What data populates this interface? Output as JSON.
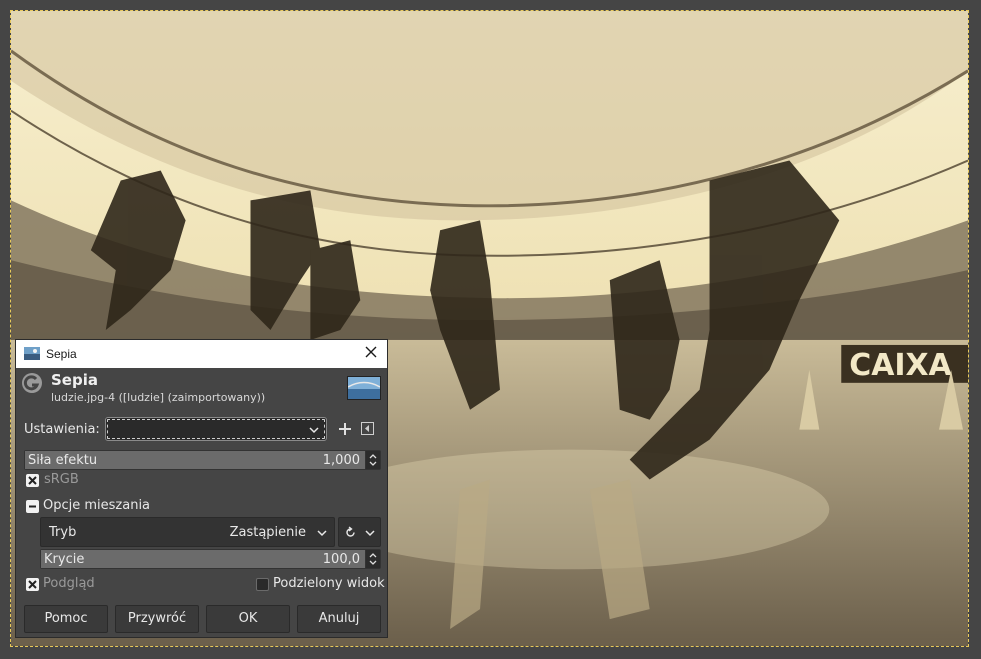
{
  "dialog": {
    "window_title": "Sepia",
    "filter_title": "Sepia",
    "image_info": "ludzie.jpg-4 ([ludzie] (zaimportowany))",
    "settings": {
      "label": "Ustawienia:",
      "value": ""
    },
    "strength": {
      "label": "Siła efektu",
      "value": "1,000",
      "fraction": 1.0
    },
    "srgb": {
      "label": "sRGB",
      "checked": true
    },
    "blending": {
      "label": "Opcje mieszania",
      "expanded": true,
      "mode_label": "Tryb",
      "mode_value": "Zastąpienie",
      "opacity_label": "Krycie",
      "opacity_value": "100,0",
      "opacity_fraction": 1.0
    },
    "preview": {
      "label": "Podgląd",
      "checked": true
    },
    "split_view": {
      "label": "Podzielony widok",
      "checked": false
    },
    "buttons": {
      "help": "Pomoc",
      "reset": "Przywróć",
      "ok": "OK",
      "cancel": "Anuluj"
    }
  },
  "canvas": {
    "banner_text": "CAIXA"
  },
  "icons": {
    "window": "gimp-window-icon",
    "logo": "gimp-logo-icon",
    "close": "close-icon",
    "add": "add-preset-icon",
    "menu": "preset-menu-icon",
    "composite": "composite-mode-icon"
  },
  "colors": {
    "sepia_light": "#f5ecc8",
    "sepia_dark": "#3a3020",
    "dialog_bg": "#454545",
    "selection_border": "#e8c95a"
  }
}
